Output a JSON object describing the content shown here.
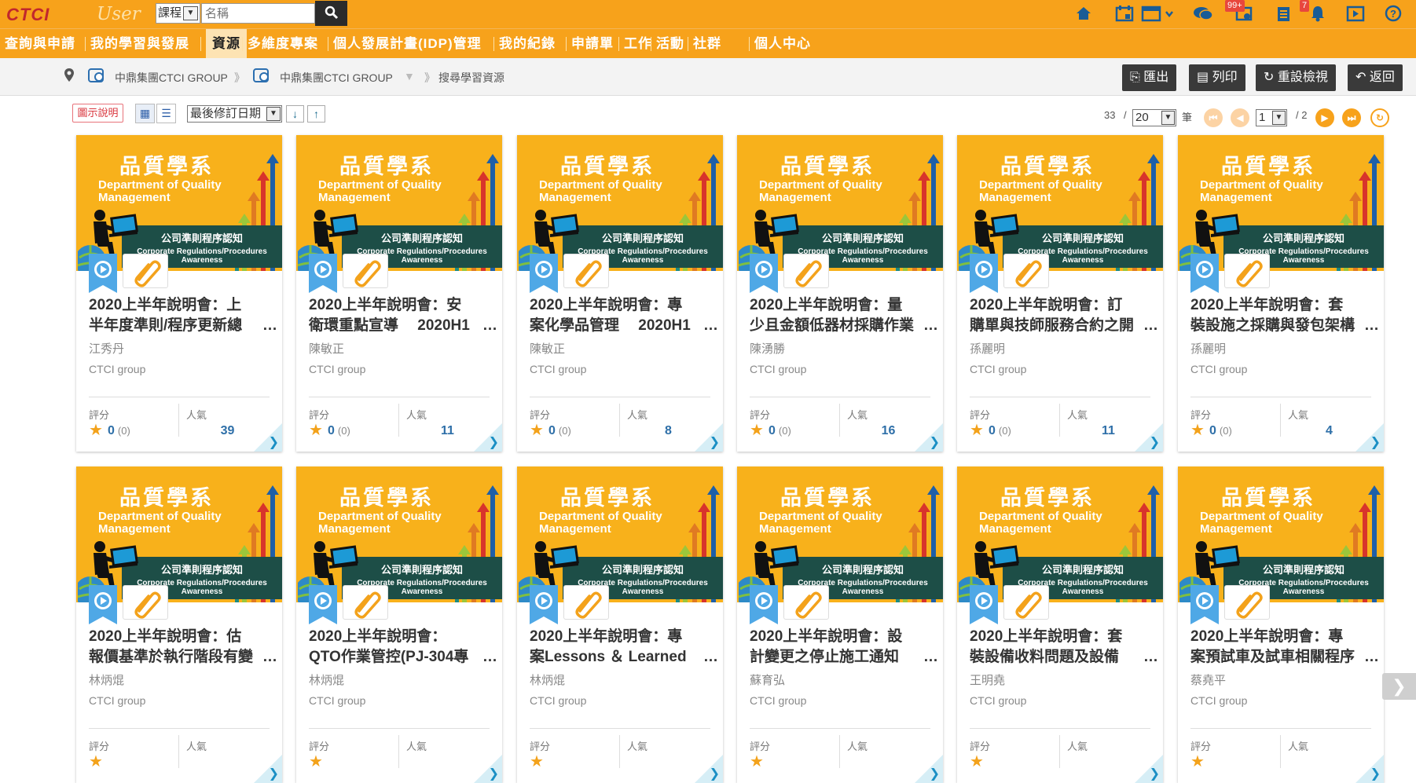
{
  "header": {
    "logo_text": "CTCI",
    "logo_user": "User",
    "search_type": "課程",
    "search_placeholder": "名稱",
    "msg_badge": "99+",
    "notif_badge": "7",
    "accent": "#f7a21b"
  },
  "nav": {
    "items": [
      "查詢與申請",
      "我的學習與發展",
      "資源",
      "多維度專案",
      "個人發展計畫(IDP)管理",
      "我的紀錄",
      "申請單",
      "工作",
      "活動",
      "社群",
      "個人中心"
    ],
    "active": "資源"
  },
  "breadcrumb": {
    "item1": "中鼎集團CTCI GROUP",
    "item2": "中鼎集團CTCI GROUP",
    "item3": "搜尋學習資源"
  },
  "actions": {
    "export": "匯出",
    "print": "列印",
    "reset": "重設檢視",
    "back": "返回"
  },
  "toolbar": {
    "legend": "圖示說明",
    "sort": "最後修訂日期",
    "total": "33",
    "slash": "/",
    "page_size": "20",
    "unit": "筆",
    "page": "1",
    "pages": "/ 2"
  },
  "thumb": {
    "title": "品質學系",
    "en1": "Department of Quality",
    "en2": "Management",
    "band_zh": "公司準則程序認知",
    "band_en1": "Corporate Regulations/Procedures",
    "band_en2": "Awareness"
  },
  "labels": {
    "score": "評分",
    "popularity": "人氣",
    "org": "CTCI group"
  },
  "cards": [
    {
      "line1": "2020上半年說明會：上",
      "line2": "半年度準則/程序更新總",
      "author": "江秀丹",
      "score": "0",
      "count": "(0)",
      "pop": "39"
    },
    {
      "line1": "2020上半年說明會：安",
      "line2": "衛環重點宣導　 2020H1",
      "author": "陳敏正",
      "score": "0",
      "count": "(0)",
      "pop": "11"
    },
    {
      "line1": "2020上半年說明會：專",
      "line2": "案化學品管理 　2020H1",
      "author": "陳敏正",
      "score": "0",
      "count": "(0)",
      "pop": "8"
    },
    {
      "line1": "2020上半年說明會：量",
      "line2": "少且金額低器材採購作業",
      "author": "陳湧勝",
      "score": "0",
      "count": "(0)",
      "pop": "16"
    },
    {
      "line1": "2020上半年說明會：訂",
      "line2": "購單與技師服務合約之開",
      "author": "孫麗明",
      "score": "0",
      "count": "(0)",
      "pop": "11"
    },
    {
      "line1": "2020上半年說明會：套",
      "line2": "裝設施之採購與發包架構",
      "author": "孫麗明",
      "score": "0",
      "count": "(0)",
      "pop": "4"
    },
    {
      "line1": "2020上半年說明會：估",
      "line2": "報價基準於執行階段有變",
      "author": "林炳焜",
      "score": "",
      "count": "",
      "pop": ""
    },
    {
      "line1": "2020上半年說明會：",
      "line2": "QTO作業管控(PJ-304專",
      "author": "林炳焜",
      "score": "",
      "count": "",
      "pop": ""
    },
    {
      "line1": "2020上半年說明會：專",
      "line2": "案Lessons ＆ Learned",
      "author": "林炳焜",
      "score": "",
      "count": "",
      "pop": ""
    },
    {
      "line1": "2020上半年說明會：設",
      "line2": "計變更之停止施工通知",
      "author": "蘇育弘",
      "score": "",
      "count": "",
      "pop": ""
    },
    {
      "line1": "2020上半年說明會：套",
      "line2": "裝設備收料問題及設備",
      "author": "王明堯",
      "score": "",
      "count": "",
      "pop": ""
    },
    {
      "line1": "2020上半年說明會：專",
      "line2": "案預試車及試車相關程序",
      "author": "蔡堯平",
      "score": "",
      "count": "",
      "pop": ""
    }
  ]
}
